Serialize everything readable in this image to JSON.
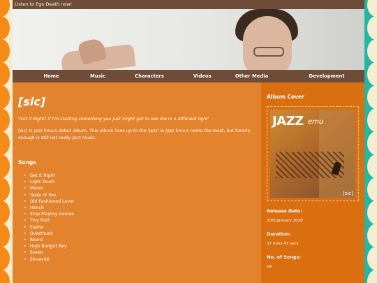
{
  "topbar": {
    "text": "Listen to Ego Death now!"
  },
  "nav": [
    "Home",
    "Music",
    "Characters",
    "Videos",
    "Other Media",
    "Development"
  ],
  "main": {
    "title": "[sic]",
    "quote": "'Get it Right! If I'm starting something you just might get to see me in a different light'",
    "description": "[sic] is Jazz Emu's debut album. This album lives up to the 'Jazz' in Jazz Emu's name the most, but funnily enough is still not really Jazz music.",
    "songs_heading": "Songs",
    "songs": [
      "Get It Right",
      "Light Touch",
      "Miami",
      "Taste of You",
      "Old Fashioned Lover",
      "Hench",
      "Stop Playing Games",
      "Tiny Butt",
      "Elaine",
      "Overthunk",
      "Beard",
      "High Budget Boy",
      "Sexier",
      "Sincerité"
    ]
  },
  "side": {
    "album_cover_heading": "Album Cover",
    "cover": {
      "brand_a": "JAZZ",
      "brand_b": "emu",
      "corner": "[sic]"
    },
    "release_label": "Release Date:",
    "release_value": "20th January 2020",
    "duration_label": "Duration:",
    "duration_value": "37 mins 47 secs",
    "songs_label": "No. of Songs:",
    "songs_value": "14"
  }
}
